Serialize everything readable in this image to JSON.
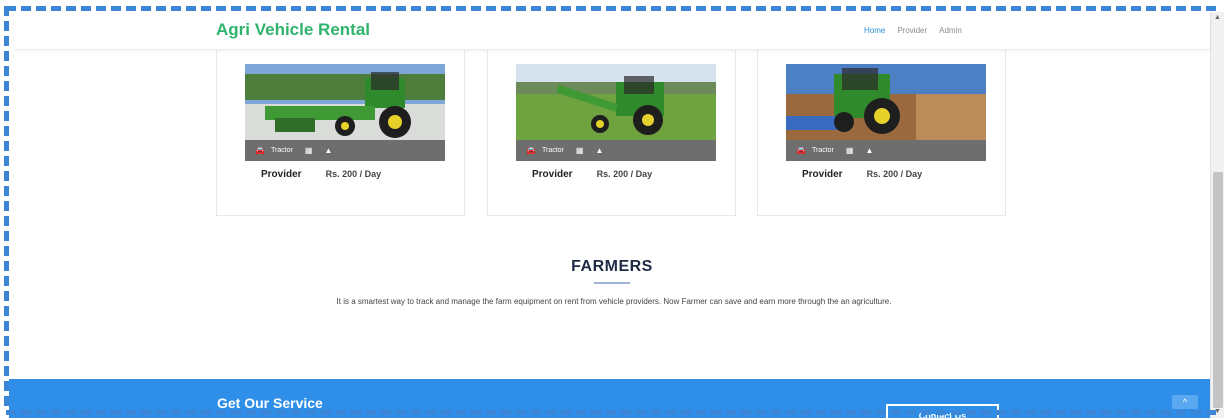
{
  "navbar": {
    "brand": "Agri Vehicle Rental",
    "links": [
      "Home",
      "Provider",
      "Admin"
    ],
    "active_link": "Home"
  },
  "cards": [
    {
      "type": "Tractor",
      "provider": "Provider",
      "price": "Rs. 200 / Day"
    },
    {
      "type": "Tractor",
      "provider": "Provider",
      "price": "Rs. 200 / Day"
    },
    {
      "type": "Tractor",
      "provider": "Provider",
      "price": "Rs. 200 / Day"
    }
  ],
  "farmers": {
    "title": "FARMERS",
    "text": "It is a smartest way to track and manage the farm equipment on rent from vehicle providers. Now Farmer can save and earn more through the an agriculture."
  },
  "footer": {
    "heading": "Get Our Service",
    "contact_label": "Contact Us",
    "back_to_top_icon": "chevron-up-icon"
  },
  "colors": {
    "brand": "#2fb36d",
    "accent": "#2f8fe8",
    "nav_active": "#2a8fd6",
    "card_bar": "#6e6e6e",
    "heading": "#1f2a44"
  },
  "icons": {
    "vehicle": "car-icon",
    "calendar": "calendar-icon",
    "user": "user-icon"
  }
}
